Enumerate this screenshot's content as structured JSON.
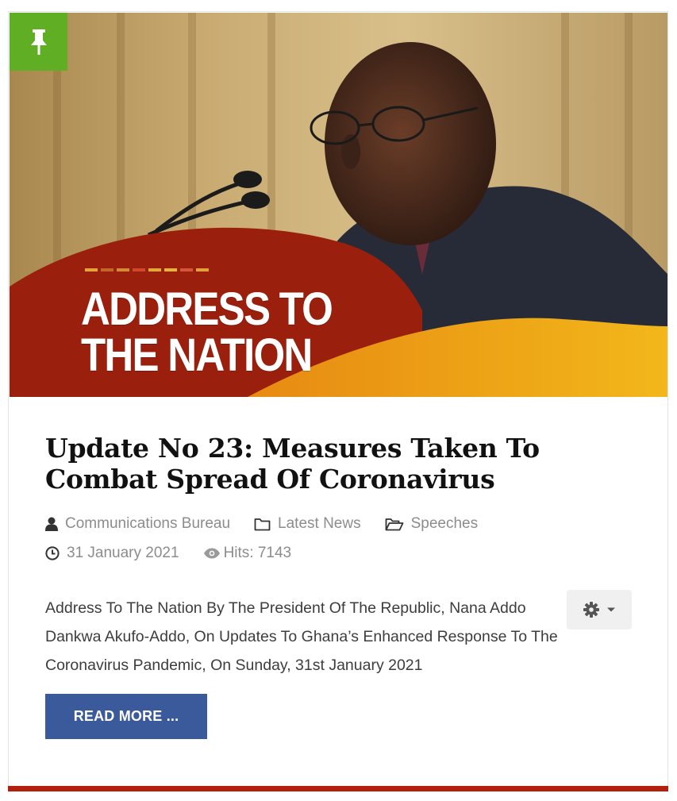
{
  "article": {
    "image_banner": {
      "line1": "ADDRESS TO",
      "line2": "THE NATION"
    },
    "pin_icon": "pushpin-icon",
    "title": "Update No 23: Measures Taken To Combat Spread Of Coronavirus",
    "meta": {
      "author": "Communications Bureau",
      "category": "Latest News",
      "subcategory": "Speeches",
      "date": "31 January 2021",
      "hits": "Hits: 7143"
    },
    "intro": "Address To The Nation By The President Of The Republic, Nana Addo Dankwa Akufo-Addo, On Updates To Ghana’s Enhanced Response To The Coronavirus Pandemic, On Sunday, 31st January 2021",
    "read_more_label": "READ MORE ..."
  },
  "colors": {
    "pin_badge": "#5fae24",
    "read_more_bg": "#3b5a9b",
    "bottom_bar": "#b4200f",
    "meta_text": "#8c8c8c"
  }
}
